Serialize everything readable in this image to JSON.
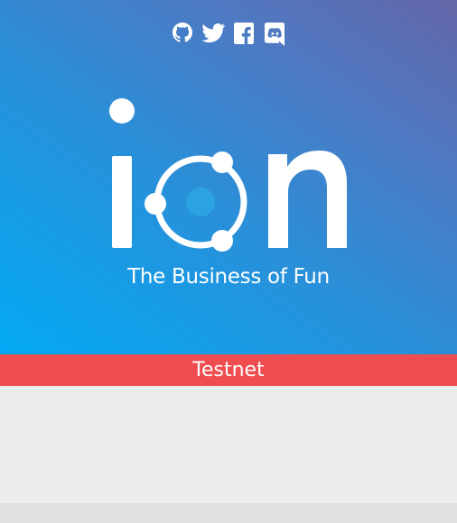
{
  "header": {
    "social_links": [
      {
        "icon": "github-icon"
      },
      {
        "icon": "twitter-icon"
      },
      {
        "icon": "facebook-icon"
      },
      {
        "icon": "discord-icon"
      }
    ]
  },
  "brand": {
    "logo_text": "ion",
    "tagline": "The Business of Fun"
  },
  "banner": {
    "label": "Testnet",
    "color": "#ef4d4f"
  },
  "colors": {
    "gradient_start": "#03a9f4",
    "gradient_end": "#6466a8",
    "page_background": "#ececec"
  }
}
